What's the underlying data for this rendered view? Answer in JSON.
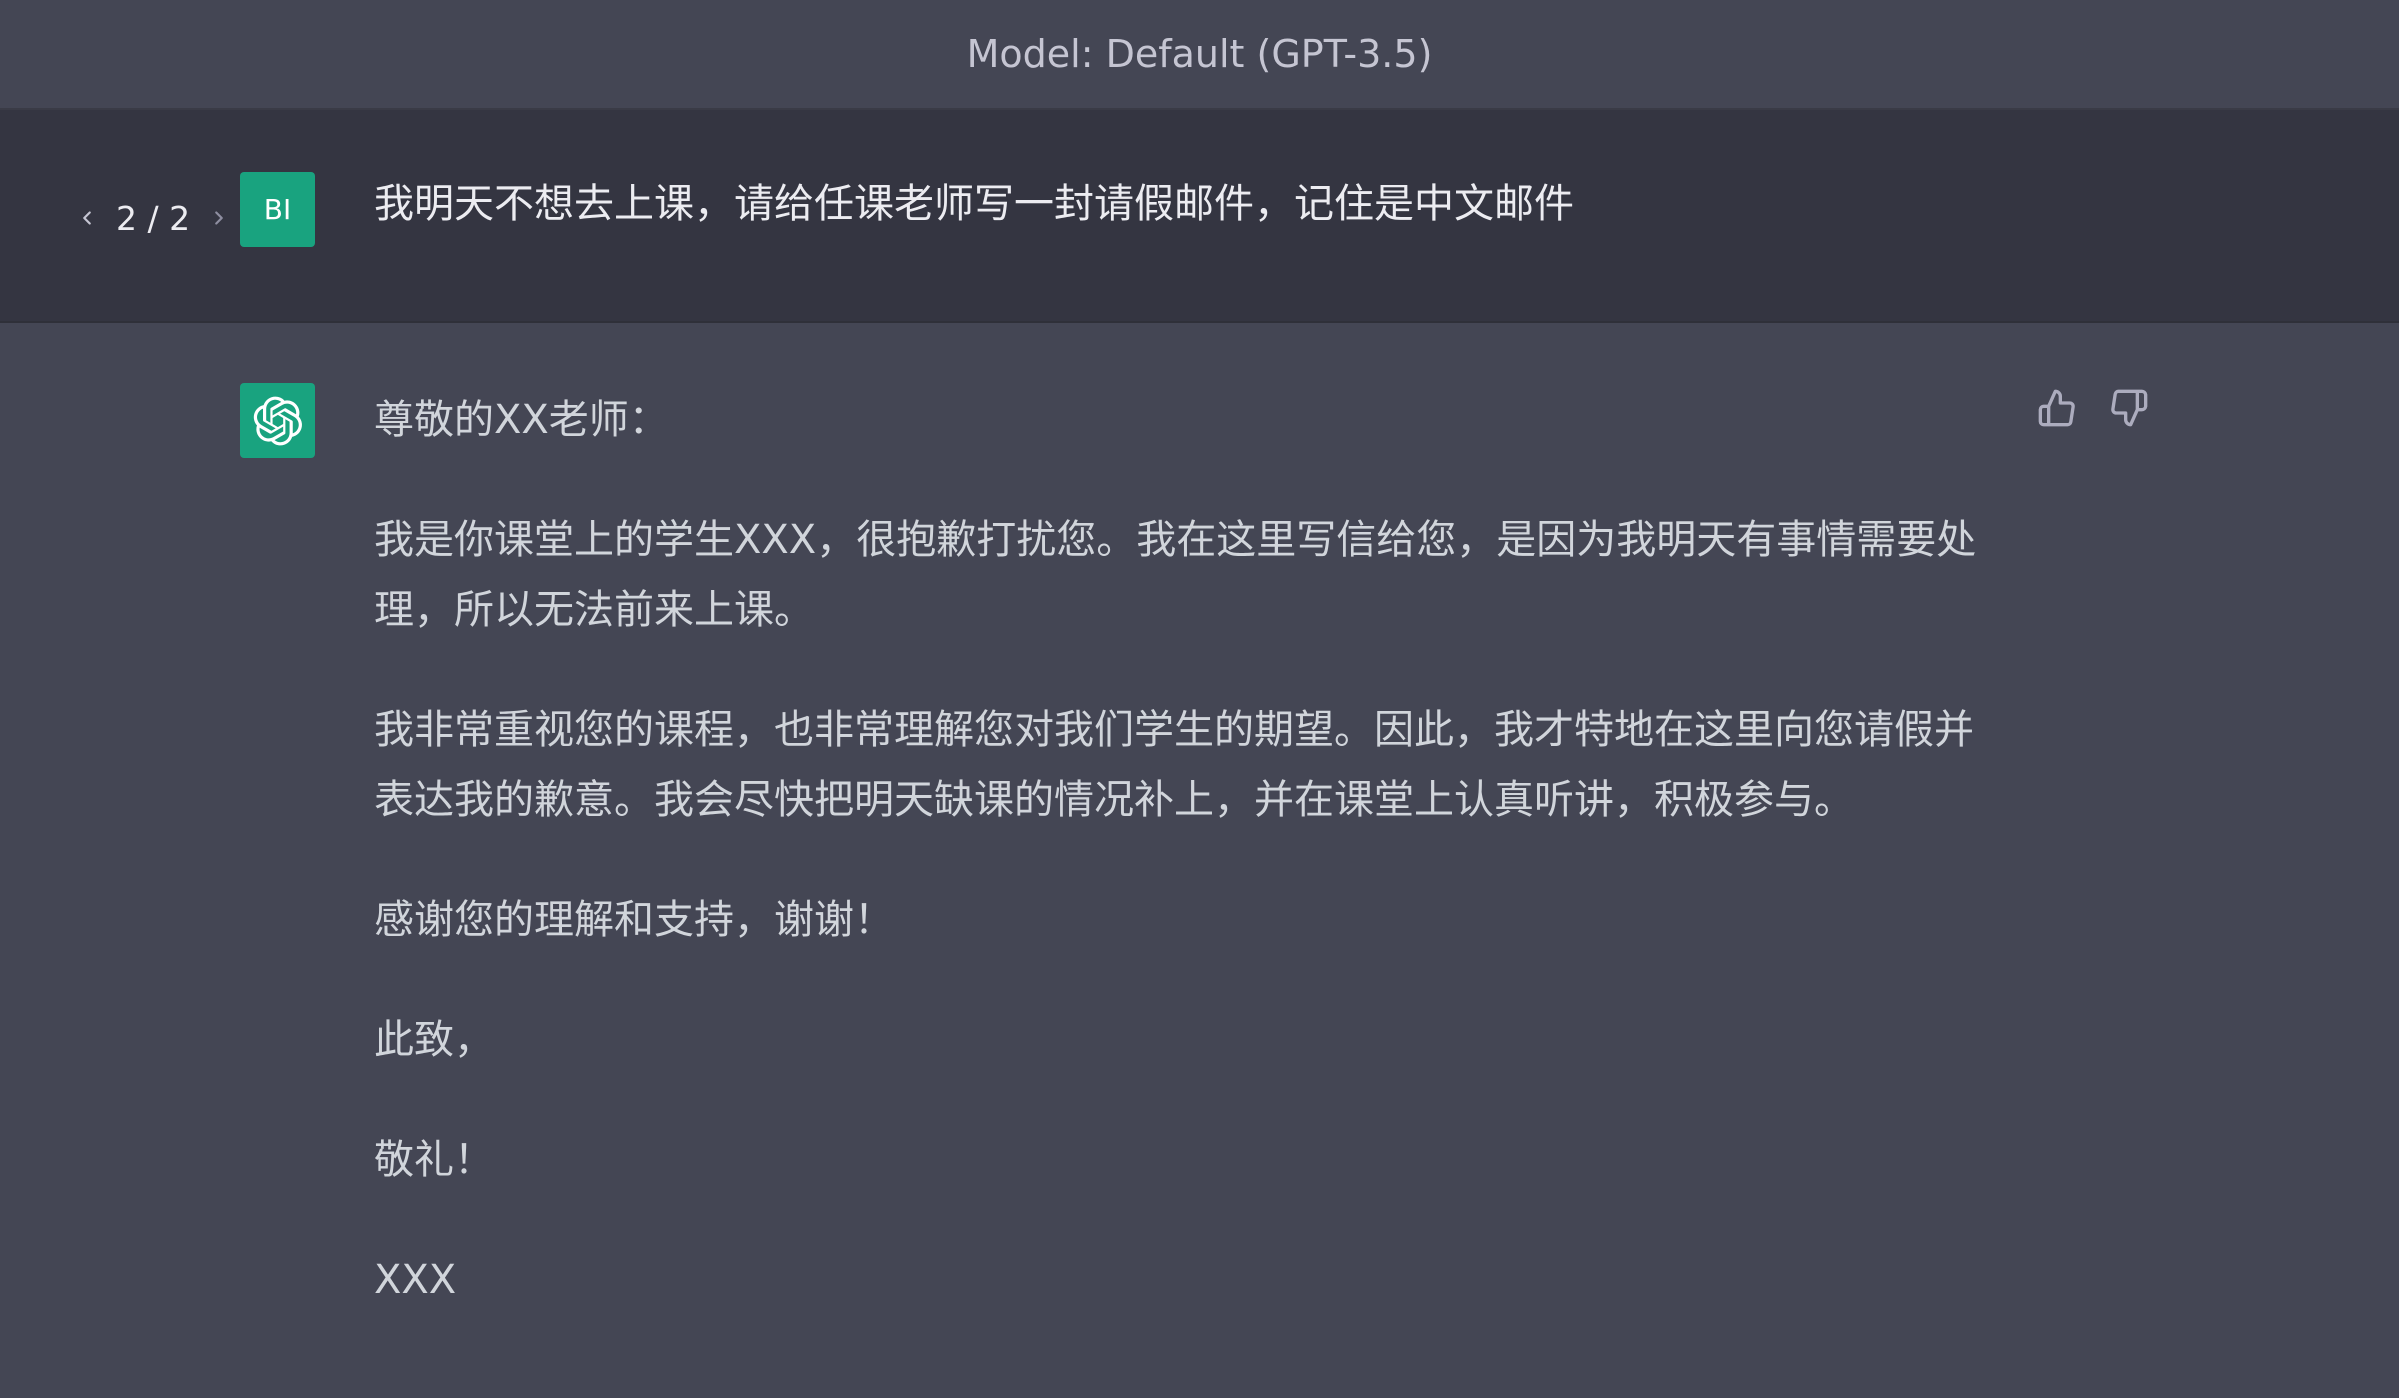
{
  "header": {
    "model_label": "Model: Default (GPT-3.5)"
  },
  "user_turn": {
    "pager": {
      "text": "2 / 2",
      "prev_icon": "chevron-left-icon",
      "next_icon": "chevron-right-icon"
    },
    "avatar_initials": "BI",
    "avatar_color": "#19a37f",
    "message": "我明天不想去上课，请给任课老师写一封请假邮件，记住是中文邮件"
  },
  "assistant_turn": {
    "avatar_icon": "openai-logo-icon",
    "avatar_color": "#19a37f",
    "paragraphs": [
      "尊敬的XX老师：",
      "我是你课堂上的学生XXX，很抱歉打扰您。我在这里写信给您，是因为我明天有事情需要处理，所以无法前来上课。",
      "我非常重视您的课程，也非常理解您对我们学生的期望。因此，我才特地在这里向您请假并表达我的歉意。我会尽快把明天缺课的情况补上，并在课堂上认真听讲，积极参与。",
      "感谢您的理解和支持，谢谢！",
      "此致，",
      "敬礼！",
      "XXX"
    ],
    "feedback": {
      "thumbs_up_icon": "thumbs-up-icon",
      "thumbs_down_icon": "thumbs-down-icon"
    }
  },
  "colors": {
    "page_bg": "#444654",
    "user_row_bg": "#343541",
    "accent": "#19a37f",
    "text_primary": "#ececf1",
    "text_secondary": "#d1d5db"
  }
}
